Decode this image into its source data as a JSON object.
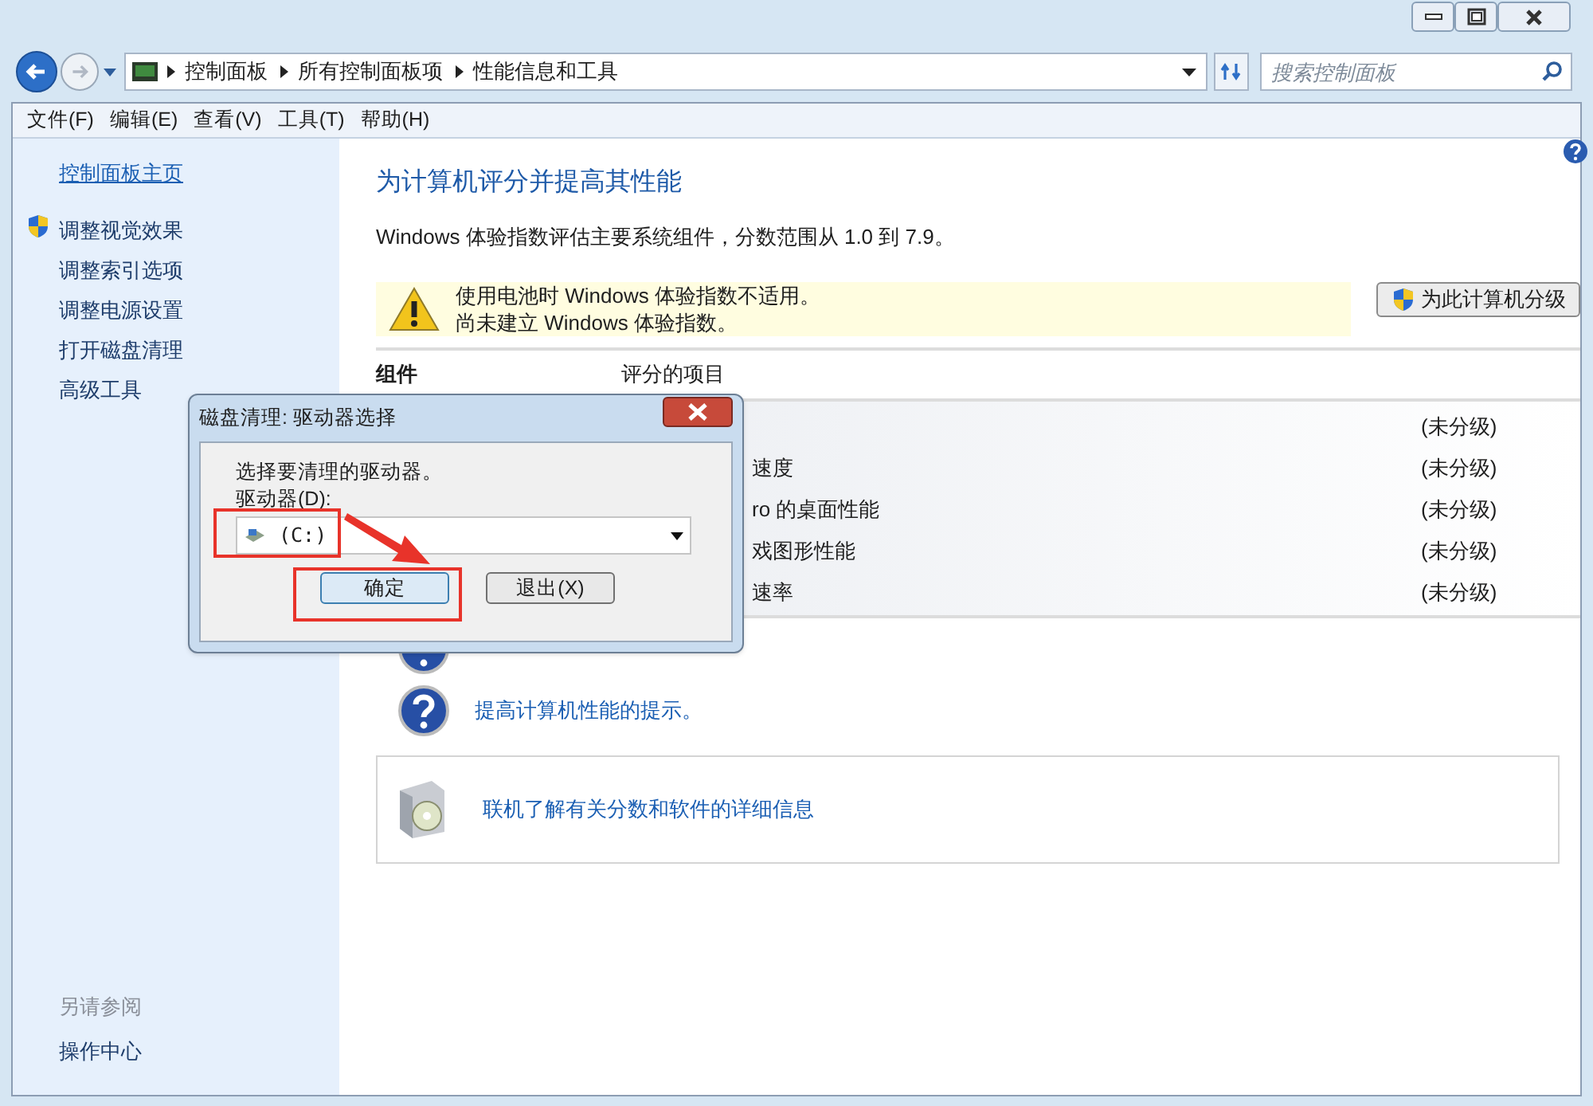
{
  "address_bar": {
    "breadcrumbs": [
      "控制面板",
      "所有控制面板项",
      "性能信息和工具"
    ],
    "search_placeholder": "搜索控制面板"
  },
  "menu": [
    "文件(F)",
    "编辑(E)",
    "查看(V)",
    "工具(T)",
    "帮助(H)"
  ],
  "sidebar": {
    "home_link": "控制面板主页",
    "items": [
      {
        "label": "调整视觉效果",
        "shield": true
      },
      {
        "label": "调整索引选项",
        "shield": false
      },
      {
        "label": "调整电源设置",
        "shield": false
      },
      {
        "label": "打开磁盘清理",
        "shield": false
      },
      {
        "label": "高级工具",
        "shield": false
      }
    ],
    "see_also_title": "另请参阅",
    "see_also": [
      "操作中心"
    ]
  },
  "content": {
    "title": "为计算机评分并提高其性能",
    "description": "Windows 体验指数评估主要系统组件，分数范围从 1.0 到 7.9。",
    "warning": [
      "使用电池时 Windows 体验指数不适用。",
      "尚未建立 Windows 体验指数。"
    ],
    "rate_button": "为此计算机分级",
    "table": {
      "columns": [
        "组件",
        "评分的项目"
      ],
      "rows": [
        {
          "item": "",
          "rating": "(未分级)"
        },
        {
          "item": "速度",
          "rating": "(未分级)"
        },
        {
          "item": "ro 的桌面性能",
          "rating": "(未分级)"
        },
        {
          "item": "戏图形性能",
          "rating": "(未分级)"
        },
        {
          "item": "速率",
          "rating": "(未分级)"
        }
      ]
    },
    "help_links": [
      "提高计算机性能的提示。"
    ],
    "online_link": "联机了解有关分数和软件的详细信息"
  },
  "dialog": {
    "title": "磁盘清理: 驱动器选择",
    "prompt": "选择要清理的驱动器。",
    "drive_label": "驱动器(D):",
    "drive_value": "(C:)",
    "buttons": [
      "确定",
      "退出(X)"
    ]
  }
}
